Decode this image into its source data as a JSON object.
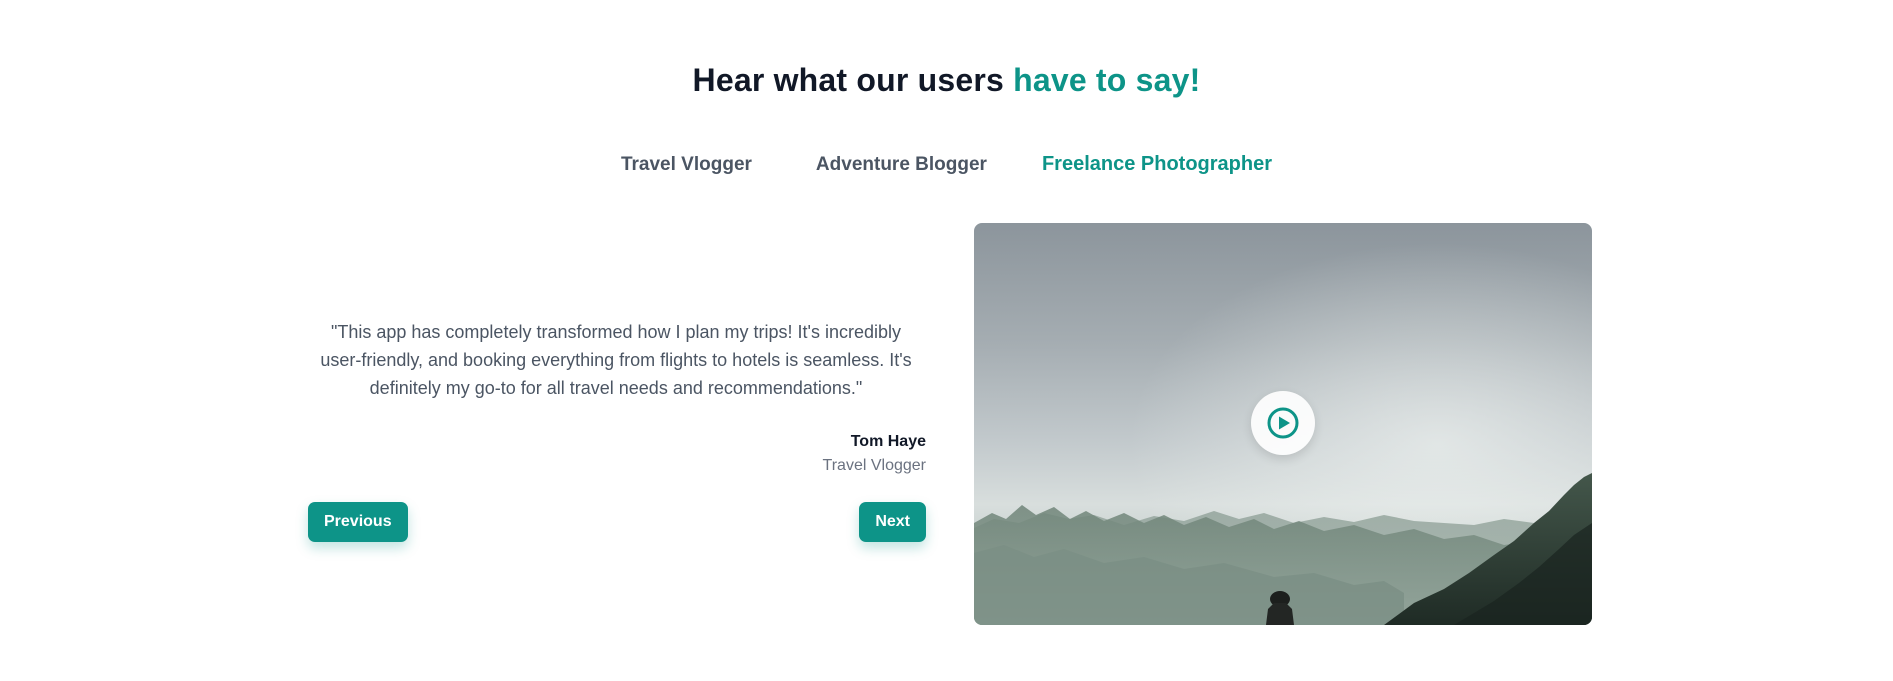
{
  "heading": {
    "text": "Hear what our users ",
    "accent": "have to say!"
  },
  "tabs": [
    {
      "label": "Travel Vlogger",
      "active": false
    },
    {
      "label": "Adventure Blogger",
      "active": false
    },
    {
      "label": "Freelance Photographer",
      "active": true
    }
  ],
  "testimonial": {
    "quote": "\"This app has completely transformed how I plan my trips! It's incredibly user-friendly, and booking everything from flights to hotels is seamless. It's definitely my go-to for all travel needs and recommendations.\"",
    "author_name": "Tom Haye",
    "author_role": "Travel Vlogger"
  },
  "buttons": {
    "previous": "Previous",
    "next": "Next"
  },
  "video": {
    "play_icon": "play-circle-icon"
  },
  "colors": {
    "accent": "#0d9488",
    "heading": "#111827",
    "body_text": "#4b5563"
  }
}
